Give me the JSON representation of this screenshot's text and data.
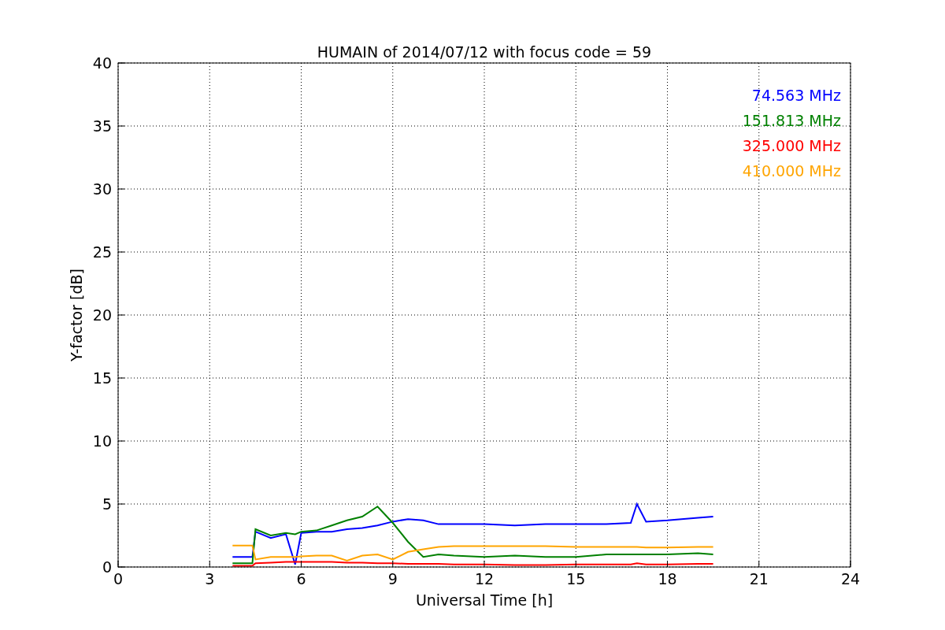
{
  "chart_data": {
    "type": "line",
    "title": "HUMAIN of 2014/07/12 with focus code = 59",
    "xlabel": "Universal Time [h]",
    "ylabel": "Y-factor [dB]",
    "x": [
      3.75,
      4.4,
      4.5,
      5,
      5.5,
      5.8,
      6,
      6.5,
      7,
      7.5,
      8,
      8.5,
      9,
      9.5,
      10,
      10.5,
      11,
      12,
      13,
      14,
      15,
      16,
      16.8,
      17,
      17.3,
      18,
      19,
      19.5
    ],
    "series": [
      {
        "name": "74.563 MHz",
        "color": "#0000ff",
        "values": [
          0.8,
          0.8,
          2.8,
          2.3,
          2.6,
          0.2,
          2.7,
          2.8,
          2.8,
          3.0,
          3.1,
          3.3,
          3.6,
          3.8,
          3.7,
          3.4,
          3.4,
          3.4,
          3.3,
          3.4,
          3.4,
          3.4,
          3.5,
          5.0,
          3.6,
          3.7,
          3.9,
          4.0
        ]
      },
      {
        "name": "151.813 MHz",
        "color": "#008000",
        "values": [
          0.3,
          0.3,
          3.0,
          2.5,
          2.7,
          2.6,
          2.8,
          2.9,
          3.3,
          3.7,
          4.0,
          4.8,
          3.5,
          2.0,
          0.8,
          1.0,
          0.9,
          0.8,
          0.9,
          0.8,
          0.8,
          1.0,
          1.0,
          1.0,
          1.0,
          1.0,
          1.1,
          1.0
        ]
      },
      {
        "name": "325.000 MHz",
        "color": "#ff0000",
        "values": [
          0.1,
          0.1,
          0.3,
          0.35,
          0.4,
          0.4,
          0.4,
          0.4,
          0.4,
          0.35,
          0.35,
          0.3,
          0.3,
          0.25,
          0.25,
          0.25,
          0.2,
          0.2,
          0.15,
          0.15,
          0.2,
          0.2,
          0.2,
          0.3,
          0.2,
          0.2,
          0.25,
          0.25
        ]
      },
      {
        "name": "410.000 MHz",
        "color": "#ffa500",
        "values": [
          1.7,
          1.7,
          0.6,
          0.8,
          0.8,
          0.8,
          0.85,
          0.9,
          0.9,
          0.5,
          0.9,
          1.0,
          0.6,
          1.2,
          1.4,
          1.6,
          1.65,
          1.65,
          1.65,
          1.65,
          1.6,
          1.6,
          1.6,
          1.6,
          1.55,
          1.55,
          1.6,
          1.6
        ]
      }
    ],
    "grid": true,
    "xlim": [
      0,
      24
    ],
    "ylim": [
      0,
      40
    ],
    "xticks": [
      0,
      3,
      6,
      9,
      12,
      15,
      18,
      21,
      24
    ],
    "yticks": [
      0,
      5,
      10,
      15,
      20,
      25,
      30,
      35,
      40
    ]
  }
}
